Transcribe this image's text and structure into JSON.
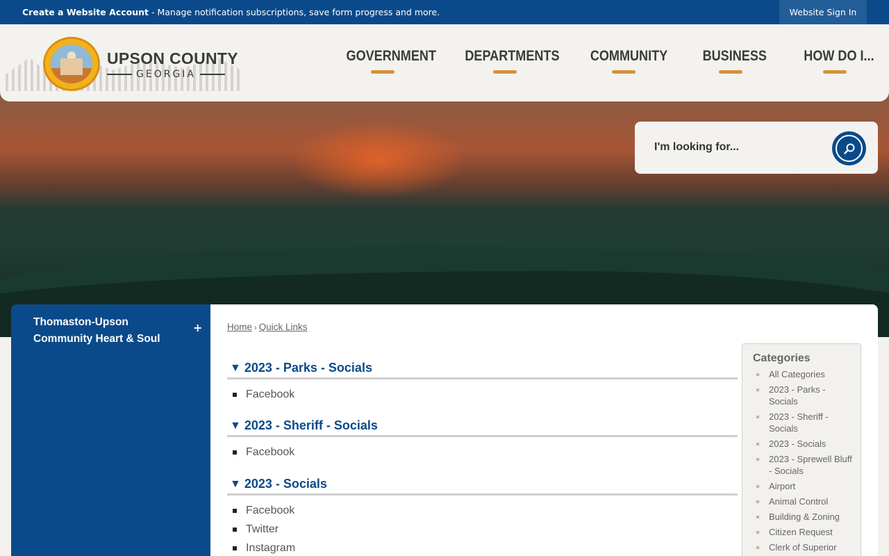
{
  "topbar": {
    "account_link": "Create a Website Account",
    "account_desc": " - Manage notification subscriptions, save form progress and more.",
    "signin": "Website Sign In"
  },
  "brand": {
    "name": "UPSON COUNTY",
    "state": "GEORGIA"
  },
  "nav": [
    "GOVERNMENT",
    "DEPARTMENTS",
    "COMMUNITY",
    "BUSINESS",
    "HOW DO I..."
  ],
  "search": {
    "placeholder": "I'm looking for...",
    "icon": "search-icon"
  },
  "sidebar": {
    "item": "Thomaston-Upson Community Heart & Soul",
    "toggle": "+"
  },
  "breadcrumb": {
    "home": "Home",
    "sep": "›",
    "current": "Quick Links"
  },
  "sections": [
    {
      "title": "2023 - Parks - Socials",
      "links": [
        "Facebook"
      ]
    },
    {
      "title": "2023 - Sheriff - Socials",
      "links": [
        "Facebook"
      ]
    },
    {
      "title": "2023 - Socials",
      "links": [
        "Facebook",
        "Twitter",
        "Instagram"
      ]
    }
  ],
  "categories": {
    "title": "Categories",
    "items": [
      "All Categories",
      "2023 - Parks - Socials",
      "2023 - Sheriff - Socials",
      "2023 - Socials",
      "2023 - Sprewell Bluff - Socials",
      "Airport",
      "Animal Control",
      "Building & Zoning",
      "Citizen Request",
      "Clerk of Superior"
    ]
  },
  "colors": {
    "primary": "#0a4a8a",
    "accent": "#d7913b",
    "header_bg": "#f4f2ef"
  }
}
